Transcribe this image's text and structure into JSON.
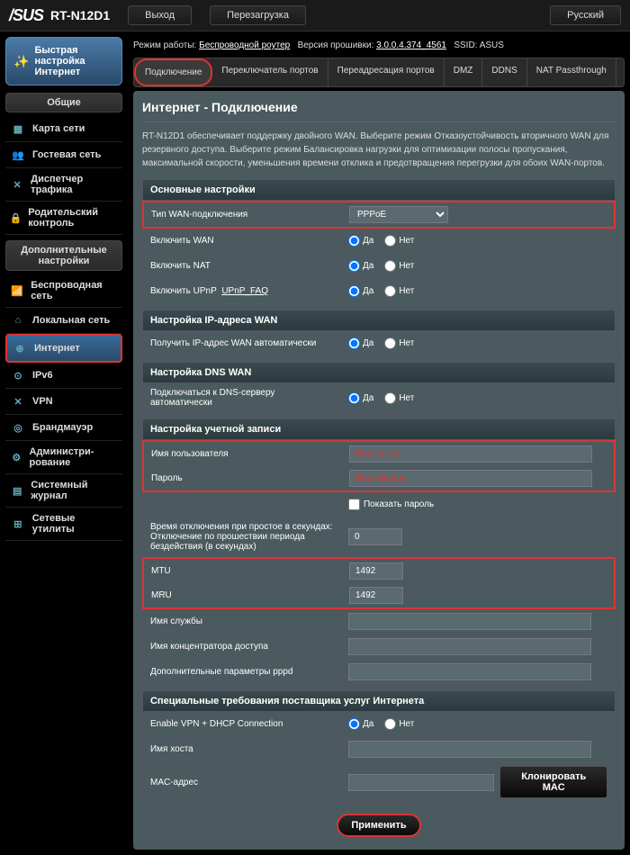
{
  "header": {
    "brand": "/SUS",
    "model": "RT-N12D1",
    "logout": "Выход",
    "reboot": "Перезагрузка",
    "language": "Русский"
  },
  "infobar": {
    "mode_label": "Режим работы:",
    "mode_value": "Беспроводной роутер",
    "fw_label": "Версия прошивки:",
    "fw_value": "3.0.0.4.374_4561",
    "ssid_label": "SSID:",
    "ssid_value": "ASUS"
  },
  "tabs": [
    "Подключение",
    "Переключатель портов",
    "Переадресация портов",
    "DMZ",
    "DDNS",
    "NAT Passthrough"
  ],
  "sidebar": {
    "quick": "Быстрая настройка Интернет",
    "general_header": "Общие",
    "general": [
      "Карта сети",
      "Гостевая сеть",
      "Диспетчер трафика",
      "Родительский контроль"
    ],
    "adv_header": "Дополнительные настройки",
    "adv": [
      "Беспроводная сеть",
      "Локальная сеть",
      "Интернет",
      "IPv6",
      "VPN",
      "Брандмауэр",
      "Администри-\nрование",
      "Системный журнал",
      "Сетевые утилиты"
    ]
  },
  "page": {
    "title": "Интернет - Подключение",
    "desc": "RT-N12D1 обеспечивает поддержку двойного WAN. Выберите режим Отказоустойчивость вторичного WAN для резервного доступа. Выберите режим Балансировка нагрузки для оптимизации полосы пропускания, максимальной скорости, уменьшения времени отклика и предотвращения перегрузки для обоих WAN-портов."
  },
  "sec_basic": "Основные настройки",
  "wan_type_label": "Тип WAN-подключения",
  "wan_type_value": "PPPoE",
  "enable_wan": "Включить WAN",
  "enable_nat": "Включить NAT",
  "enable_upnp": "Включить UPnP",
  "upnp_faq": "UPnP_FAQ",
  "yes": "Да",
  "no": "Нет",
  "sec_wanip": "Настройка IP-адреса WAN",
  "wanip_auto": "Получить IP-адрес WAN автоматически",
  "sec_dns": "Настройка DNS WAN",
  "dns_auto": "Подключаться к DNS-серверу автоматически",
  "sec_account": "Настройка учетной записи",
  "username": "Имя пользователя",
  "username_ph": "Ваш логин",
  "password": "Пароль",
  "password_ph": "Ваш пароль",
  "show_pw": "Показать пароль",
  "idle": "Время отключения при простое в секундах: Отключение по прошествии периода бездействия (в секундах)",
  "idle_val": "0",
  "mtu": "MTU",
  "mtu_val": "1492",
  "mru": "MRU",
  "mru_val": "1492",
  "service": "Имя службы",
  "concentrator": "Имя концентратора доступа",
  "pppd_extra": "Дополнительные параметры pppd",
  "sec_isp": "Специальные требования поставщика услуг Интернета",
  "vpn_dhcp": "Enable VPN + DHCP Connection",
  "hostname": "Имя хоста",
  "mac": "MAC-адрес",
  "clone_mac": "Клонировать MAC",
  "apply": "Применить"
}
